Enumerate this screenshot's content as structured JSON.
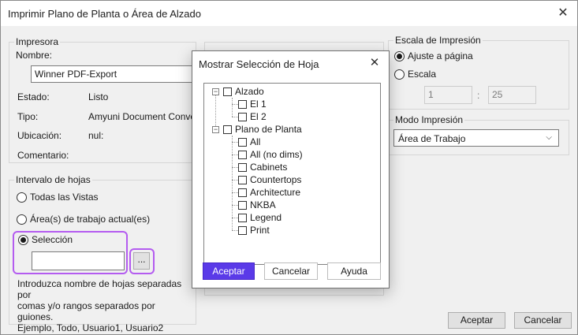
{
  "window": {
    "title": "Imprimir Plano de Planta o Área de Alzado",
    "close_icon": "✕"
  },
  "printer": {
    "legend": "Impresora",
    "name_label": "Nombre:",
    "name_value": "Winner PDF-Export",
    "state_label": "Estado:",
    "state_value": "Listo",
    "type_label": "Tipo:",
    "type_value": "Amyuni Document Converter",
    "location_label": "Ubicación:",
    "location_value": "nul:",
    "comment_label": "Comentario:"
  },
  "range": {
    "legend": "Intervalo de hojas",
    "all_views": "Todas las Vistas",
    "current_areas": "Área(s) de trabajo actual(es)",
    "selection": "Selección",
    "browse_button": "...",
    "note_1": "Introduzca nombre de hojas separadas por",
    "note_2": "comas y/o rangos separados por guiones.",
    "note_3": "Ejemplo, Todo, Usuario1, Usuario2"
  },
  "scale": {
    "legend": "Escala de Impresión",
    "fit_page": "Ajuste a página",
    "scale": "Escala",
    "value_1": "1",
    "separator": ":",
    "value_2": "25"
  },
  "mode": {
    "legend": "Modo Impresión",
    "selected": "Área de Trabajo"
  },
  "footer": {
    "accept": "Aceptar",
    "cancel": "Cancelar"
  },
  "modal": {
    "title": "Mostrar Selección de Hoja",
    "close_icon": "✕",
    "groups": [
      {
        "label": "Alzado",
        "children": [
          "El 1",
          "El 2"
        ]
      },
      {
        "label": "Plano de Planta",
        "children": [
          "All",
          "All (no dims)",
          "Cabinets",
          "Countertops",
          "Architecture",
          "NKBA",
          "Legend",
          "Print"
        ]
      }
    ],
    "accept": "Aceptar",
    "cancel": "Cancelar",
    "help": "Ayuda"
  },
  "colors": {
    "accent": "#5a3ae8",
    "highlight": "#b45cf0"
  }
}
